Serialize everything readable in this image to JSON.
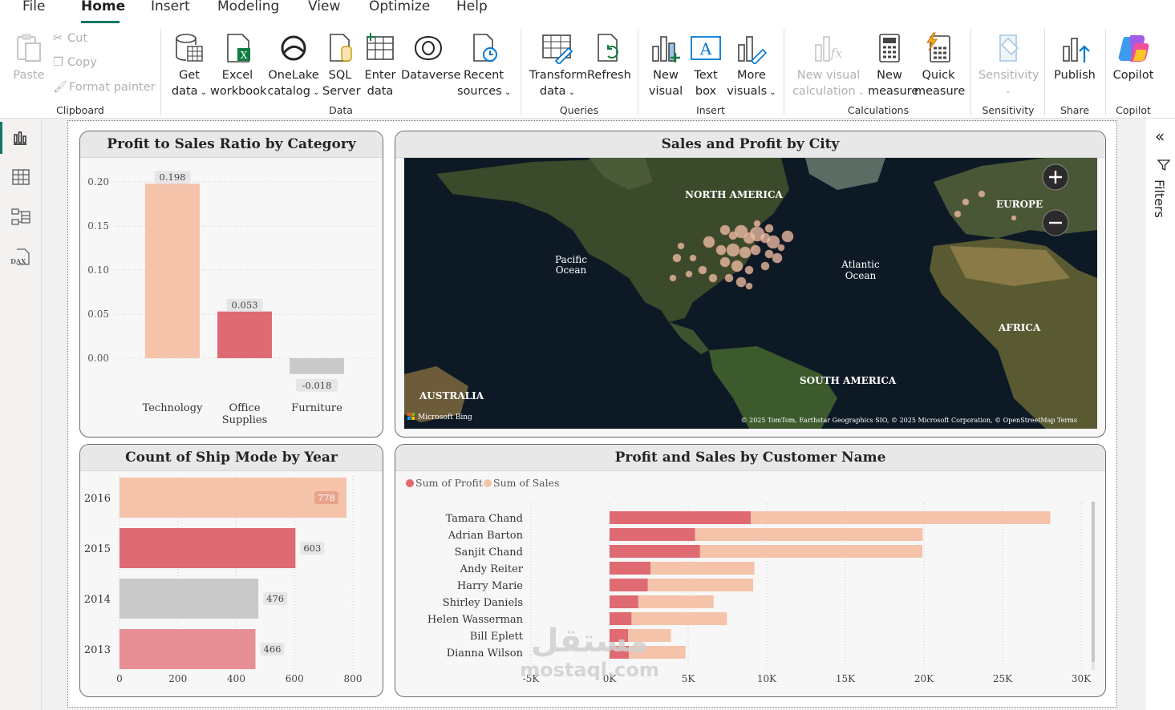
{
  "menu": {
    "items": [
      "File",
      "Home",
      "Insert",
      "Modeling",
      "View",
      "Optimize",
      "Help"
    ],
    "active": "Home"
  },
  "ribbon": {
    "clipboard": {
      "paste": "Paste",
      "cut": "Cut",
      "copy": "Copy",
      "format_painter": "Format painter",
      "group": "Clipboard"
    },
    "data": {
      "get_data": [
        "Get",
        "data"
      ],
      "excel": [
        "Excel",
        "workbook"
      ],
      "onelake": [
        "OneLake",
        "catalog"
      ],
      "sql": [
        "SQL",
        "Server"
      ],
      "enter": [
        "Enter",
        "data"
      ],
      "dataverse": "Dataverse",
      "recent": [
        "Recent",
        "sources"
      ],
      "group": "Data"
    },
    "queries": {
      "transform": [
        "Transform",
        "data"
      ],
      "refresh": "Refresh",
      "group": "Queries"
    },
    "insert": {
      "new_visual": [
        "New",
        "visual"
      ],
      "text_box": [
        "Text",
        "box"
      ],
      "more_visuals": [
        "More",
        "visuals"
      ],
      "group": "Insert"
    },
    "calculations": {
      "new_visual_calc": [
        "New visual",
        "calculation"
      ],
      "new_measure": [
        "New",
        "measure"
      ],
      "quick_measure": [
        "Quick",
        "measure"
      ],
      "group": "Calculations"
    },
    "sensitivity": {
      "label": "Sensitivity",
      "group": "Sensitivity"
    },
    "share": {
      "publish": "Publish",
      "group": "Share"
    },
    "copilot": {
      "label": "Copilot",
      "group": "Copilot"
    }
  },
  "right_pane": {
    "filters_label": "Filters"
  },
  "colors": {
    "peach": "#f4c3aa",
    "red": "#e06a72",
    "gray": "#c9c9c9",
    "pink": "#e88f95",
    "accent": "#117865"
  },
  "visuals": {
    "ratio_chart": {
      "title": "Profit to Sales Ratio by Category"
    },
    "map": {
      "title": "Sales and Profit by City",
      "labels": {
        "north_america": "NORTH AMERICA",
        "europe": "EUROPE",
        "pacific": [
          "Pacific",
          "Ocean"
        ],
        "atlantic": [
          "Atlantic",
          "Ocean"
        ],
        "africa": "AFRICA",
        "south_america": "SOUTH AMERICA",
        "australia": "AUSTRALIA"
      },
      "bing": "Microsoft Bing",
      "attribution": "© 2025 TomTom, Earthstar Geographics SIO, © 2025 Microsoft Corporation, © OpenStreetMap  Terms"
    },
    "ship_chart": {
      "title": "Count of Ship Mode by Year"
    },
    "customer_chart": {
      "title": "Profit and Sales by Customer Name"
    }
  },
  "watermark": {
    "arabic": "مستقل",
    "latin": "mostaql.com"
  },
  "chart_data": [
    {
      "type": "bar",
      "title": "Profit to Sales Ratio by Category",
      "categories": [
        "Technology",
        "Office Supplies",
        "Furniture"
      ],
      "values": [
        0.198,
        0.053,
        -0.018
      ],
      "data_labels": [
        "0.198",
        "0.053",
        "-0.018"
      ],
      "colors": [
        "#f4c3aa",
        "#e06a72",
        "#c9c9c9"
      ],
      "ylim": [
        -0.02,
        0.2
      ],
      "yticks": [
        "0.20",
        "0.15",
        "0.10",
        "0.05",
        "0.00"
      ],
      "ytick_values": [
        0.2,
        0.15,
        0.1,
        0.05,
        0.0
      ],
      "grid": true
    },
    {
      "type": "bar",
      "orientation": "horizontal",
      "title": "Count of Ship Mode by Year",
      "categories": [
        "2016",
        "2015",
        "2014",
        "2013"
      ],
      "values": [
        778,
        603,
        476,
        466
      ],
      "colors": [
        "#f4c3aa",
        "#e06a72",
        "#c9c9c9",
        "#e88f95"
      ],
      "xlim": [
        0,
        850
      ],
      "xticks": [
        "0",
        "200",
        "400",
        "600",
        "800"
      ],
      "xtick_values": [
        0,
        200,
        400,
        600,
        800
      ],
      "grid": true
    },
    {
      "type": "bar",
      "orientation": "horizontal",
      "stacked": true,
      "title": "Profit and Sales by Customer Name",
      "categories": [
        "Tamara Chand",
        "Adrian Barton",
        "Sanjit Chand",
        "Andy Reiter",
        "Harry Marie",
        "Shirley Daniels",
        "Helen Wasserman",
        "Bill Eplett",
        "Dianna Wilson"
      ],
      "series": [
        {
          "name": "Sum of Profit",
          "color": "#e06a72",
          "values": [
            8981,
            5444,
            5757,
            2607,
            2438,
            1830,
            1398,
            1186,
            1230
          ]
        },
        {
          "name": "Sum of Sales",
          "color": "#f4c3aa",
          "values": [
            19052,
            14473,
            14142,
            6608,
            6697,
            4788,
            6070,
            2714,
            3601
          ]
        }
      ],
      "xlim": [
        -5000,
        30500
      ],
      "xticks": [
        "-5K",
        "0K",
        "5K",
        "10K",
        "15K",
        "20K",
        "25K",
        "30K"
      ],
      "xtick_values": [
        -5000,
        0,
        5000,
        10000,
        15000,
        20000,
        25000,
        30000
      ],
      "legend": "top-left",
      "grid": true
    }
  ]
}
